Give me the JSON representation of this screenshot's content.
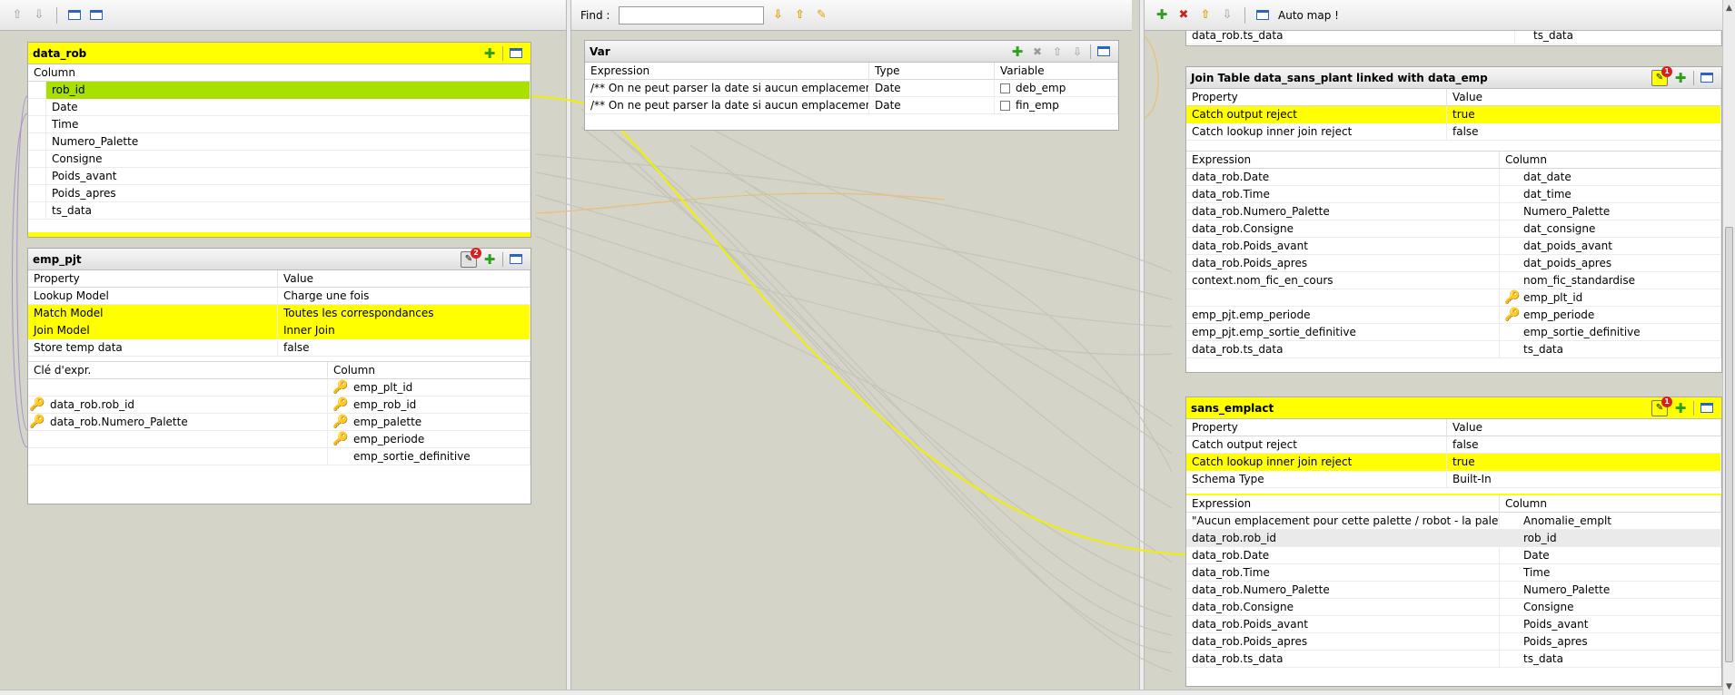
{
  "left": {
    "data_rob": {
      "title": "data_rob",
      "column_header": "Column",
      "columns": [
        "rob_id",
        "Date",
        "Time",
        "Numero_Palette",
        "Consigne",
        "Poids_avant",
        "Poids_apres",
        "ts_data"
      ]
    },
    "emp_pjt": {
      "title": "emp_pjt",
      "filter_badge": "2",
      "prop_headers": [
        "Property",
        "Value"
      ],
      "props": [
        {
          "p": "Lookup Model",
          "v": "Charge une fois"
        },
        {
          "p": "Match Model",
          "v": "Toutes les correspondances"
        },
        {
          "p": "Join Model",
          "v": "Inner Join"
        },
        {
          "p": "Store temp data",
          "v": "false"
        }
      ],
      "expr_headers": [
        "Clé d'expr.",
        "Column"
      ],
      "rows": [
        {
          "e": "",
          "c": "emp_plt_id"
        },
        {
          "e": "data_rob.rob_id",
          "c": "emp_rob_id"
        },
        {
          "e": "data_rob.Numero_Palette",
          "c": "emp_palette"
        },
        {
          "e": "",
          "c": "emp_periode"
        },
        {
          "e": "",
          "c": "emp_sortie_definitive"
        }
      ]
    }
  },
  "mid": {
    "toolbar": {
      "find_label": "Find :",
      "find_value": ""
    },
    "var": {
      "title": "Var",
      "headers": [
        "Expression",
        "Type",
        "Variable"
      ],
      "rows": [
        {
          "e": "/** On ne peut parser la date si aucun emplacement a ...",
          "t": "Date",
          "v": "deb_emp"
        },
        {
          "e": "/** On ne peut parser la date si aucun emplacement a ...",
          "t": "Date",
          "v": "fin_emp"
        }
      ]
    }
  },
  "right": {
    "toolbar": {
      "automap_label": "Auto map !"
    },
    "top_partial": {
      "e": "data_rob.ts_data",
      "c": "ts_data"
    },
    "join_table": {
      "title": "Join Table data_sans_plant linked with data_emp",
      "filter_badge": "1",
      "prop_headers": [
        "Property",
        "Value"
      ],
      "props": [
        {
          "p": "Catch output reject",
          "v": "true"
        },
        {
          "p": "Catch lookup inner join reject",
          "v": "false"
        }
      ],
      "expr_headers": [
        "Expression",
        "Column"
      ],
      "rows": [
        {
          "e": "data_rob.Date",
          "c": "dat_date"
        },
        {
          "e": "data_rob.Time",
          "c": "dat_time"
        },
        {
          "e": "data_rob.Numero_Palette",
          "c": "Numero_Palette"
        },
        {
          "e": "data_rob.Consigne",
          "c": "dat_consigne"
        },
        {
          "e": "data_rob.Poids_avant",
          "c": "dat_poids_avant"
        },
        {
          "e": "data_rob.Poids_apres",
          "c": "dat_poids_apres"
        },
        {
          "e": "context.nom_fic_en_cours",
          "c": "nom_fic_standardise"
        },
        {
          "e": "",
          "c": "emp_plt_id"
        },
        {
          "e": "emp_pjt.emp_periode",
          "c": "emp_periode"
        },
        {
          "e": "emp_pjt.emp_sortie_definitive",
          "c": "emp_sortie_definitive"
        },
        {
          "e": "data_rob.ts_data",
          "c": "ts_data"
        }
      ]
    },
    "sans_emplact": {
      "title": "sans_emplact",
      "filter_badge": "1",
      "prop_headers": [
        "Property",
        "Value"
      ],
      "props": [
        {
          "p": "Catch output reject",
          "v": "false"
        },
        {
          "p": "Catch lookup inner join reject",
          "v": "true"
        },
        {
          "p": "Schema Type",
          "v": "Built-In"
        }
      ],
      "expr_headers": [
        "Expression",
        "Column"
      ],
      "rows": [
        {
          "e": "\"Aucun emplacement pour cette palette / robot - la palette e...",
          "c": "Anomalie_emplt"
        },
        {
          "e": "data_rob.rob_id",
          "c": "rob_id"
        },
        {
          "e": "data_rob.Date",
          "c": "Date"
        },
        {
          "e": "data_rob.Time",
          "c": "Time"
        },
        {
          "e": "data_rob.Numero_Palette",
          "c": "Numero_Palette"
        },
        {
          "e": "data_rob.Consigne",
          "c": "Consigne"
        },
        {
          "e": "data_rob.Poids_avant",
          "c": "Poids_avant"
        },
        {
          "e": "data_rob.Poids_apres",
          "c": "Poids_apres"
        },
        {
          "e": "data_rob.ts_data",
          "c": "ts_data"
        }
      ]
    }
  },
  "colors": {
    "highlight": "#ffff00",
    "selected_green": "#a8e000",
    "link_yellow": "#f0f000",
    "link_grey": "#bfbfb4",
    "key_purple": "#9933aa"
  }
}
